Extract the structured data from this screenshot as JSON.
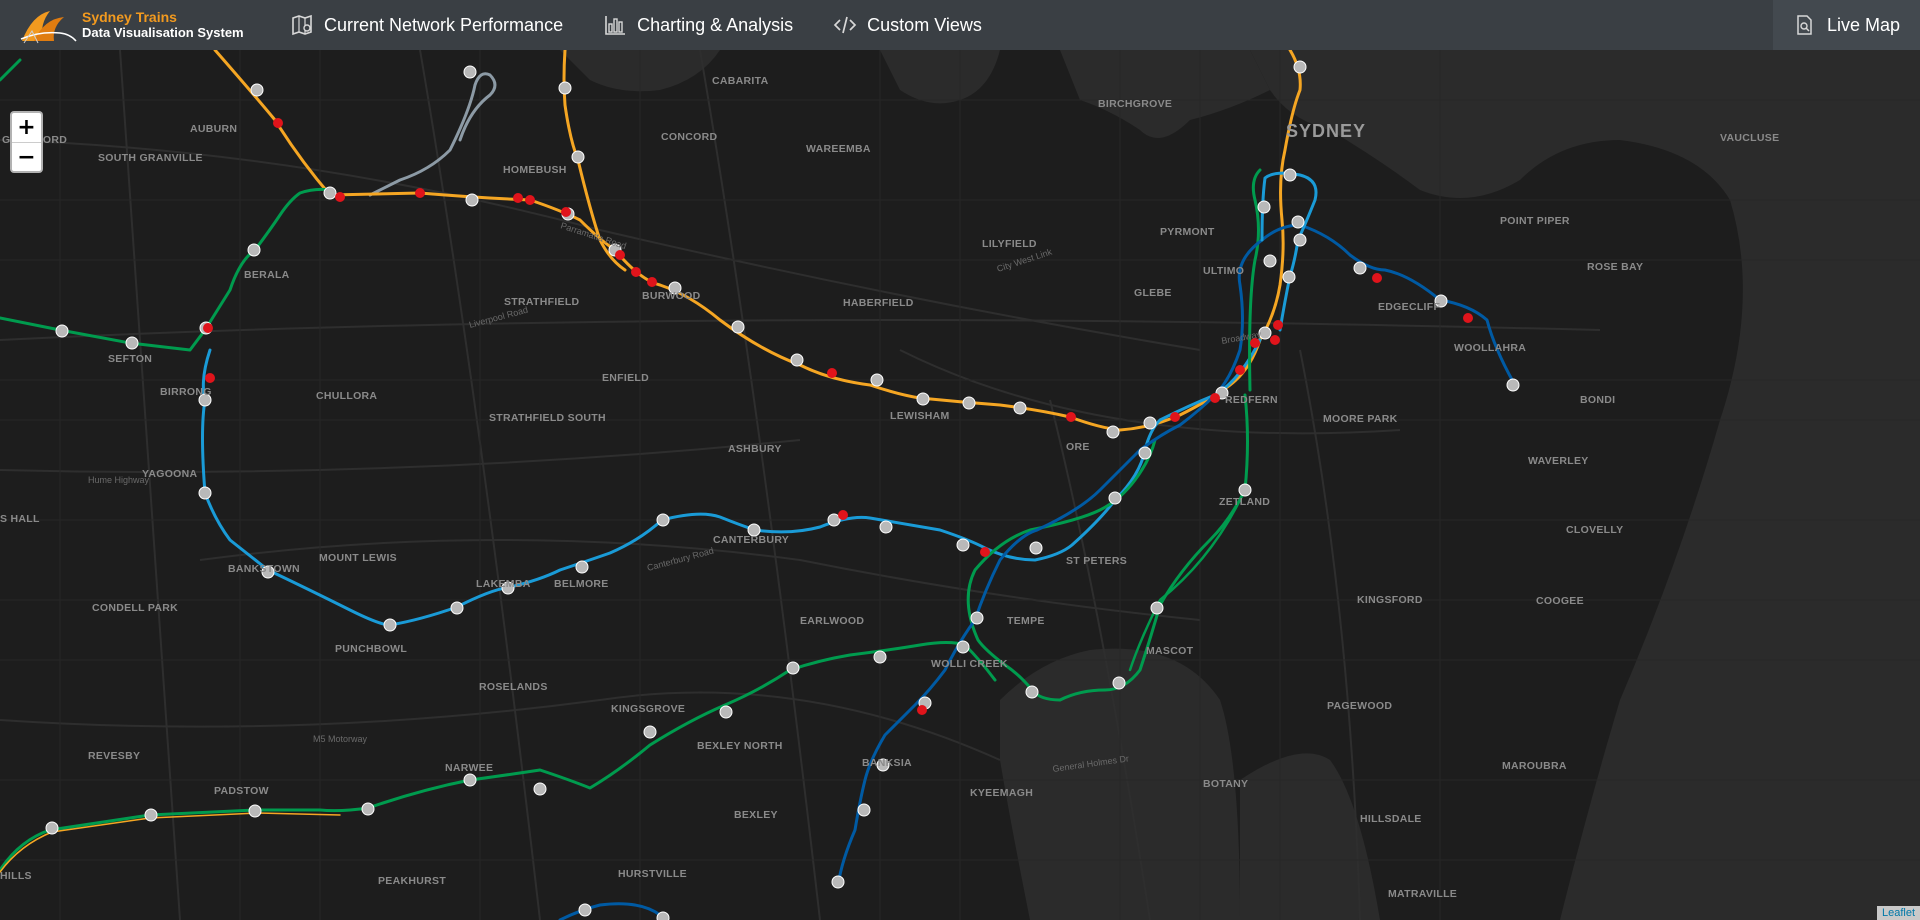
{
  "brand": {
    "title": "Sydney Trains",
    "subtitle": "Data Visualisation System"
  },
  "nav": {
    "items": [
      {
        "label": "Current Network Performance",
        "icon": "network-map-icon"
      },
      {
        "label": "Charting & Analysis",
        "icon": "bar-chart-icon"
      },
      {
        "label": "Custom Views",
        "icon": "code-icon"
      }
    ],
    "right": {
      "label": "Live Map",
      "icon": "document-search-icon"
    }
  },
  "map": {
    "city_label": "SYDNEY",
    "suburbs": [
      "CABARITA",
      "BIRCHGROVE",
      "AUBURN",
      "CONCORD",
      "WAREEMBA",
      "GUILDFORD",
      "SOUTH GRANVILLE",
      "HOMEBUSH",
      "PYRMONT",
      "LILYFIELD",
      "VAUCLUSE",
      "POINT PIPER",
      "ROSE BAY",
      "BERALA",
      "STRATHFIELD",
      "HABERFIELD",
      "GLEBE",
      "ULTIMO",
      "EDGECLIFF",
      "WOOLLAHRA",
      "SEFTON",
      "ENFIELD",
      "BURWOOD",
      "BIRRONG",
      "CHULLORA",
      "STRATHFIELD SOUTH",
      "LEWISHAM",
      "REDFERN",
      "MOORE PARK",
      "BONDI",
      "ASHBURY",
      "WAVERLEY",
      "YAGOONA",
      "ZETLAND",
      "CLOVELLY",
      "MOUNT LEWIS",
      "CANTERBURY",
      "ST PETERS",
      "BANKSTOWN",
      "LAKEMBA",
      "BELMORE",
      "KINGSFORD",
      "COOGEE",
      "CONDELL PARK",
      "EARLWOOD",
      "TEMPE",
      "PUNCHBOWL",
      "MASCOT",
      "ROSELANDS",
      "WOLLI CREEK",
      "KINGSGROVE",
      "PAGEWOOD",
      "BEXLEY NORTH",
      "REVESBY",
      "NARWEE",
      "BANKSIA",
      "MAROUBRA",
      "PADSTOW",
      "BOTANY",
      "KYEEMAGH",
      "BEXLEY",
      "HILLSDALE",
      "PEAKHURST",
      "HURSTVILLE",
      "MATRAVILLE",
      "HILLS",
      "S HALL",
      "ORE"
    ],
    "roads": [
      "Parramatta Road",
      "Liverpool Road",
      "Hume Highway",
      "Canterbury Road",
      "M5 Motorway",
      "Broadway",
      "City West Link",
      "General Holmes Dr"
    ],
    "zoom_in": "+",
    "zoom_out": "−",
    "attribution": "Leaflet"
  },
  "colors": {
    "topbar": "#3a3f44",
    "brand_orange": "#f29a1f",
    "line_t1": "#f5a623",
    "line_t2": "#1a9bd7",
    "line_t8": "#009b4e",
    "line_t4": "#005aa3",
    "line_grey": "#8c9aa5",
    "station": "#b9b9b9",
    "delayed": "#e0141b"
  }
}
